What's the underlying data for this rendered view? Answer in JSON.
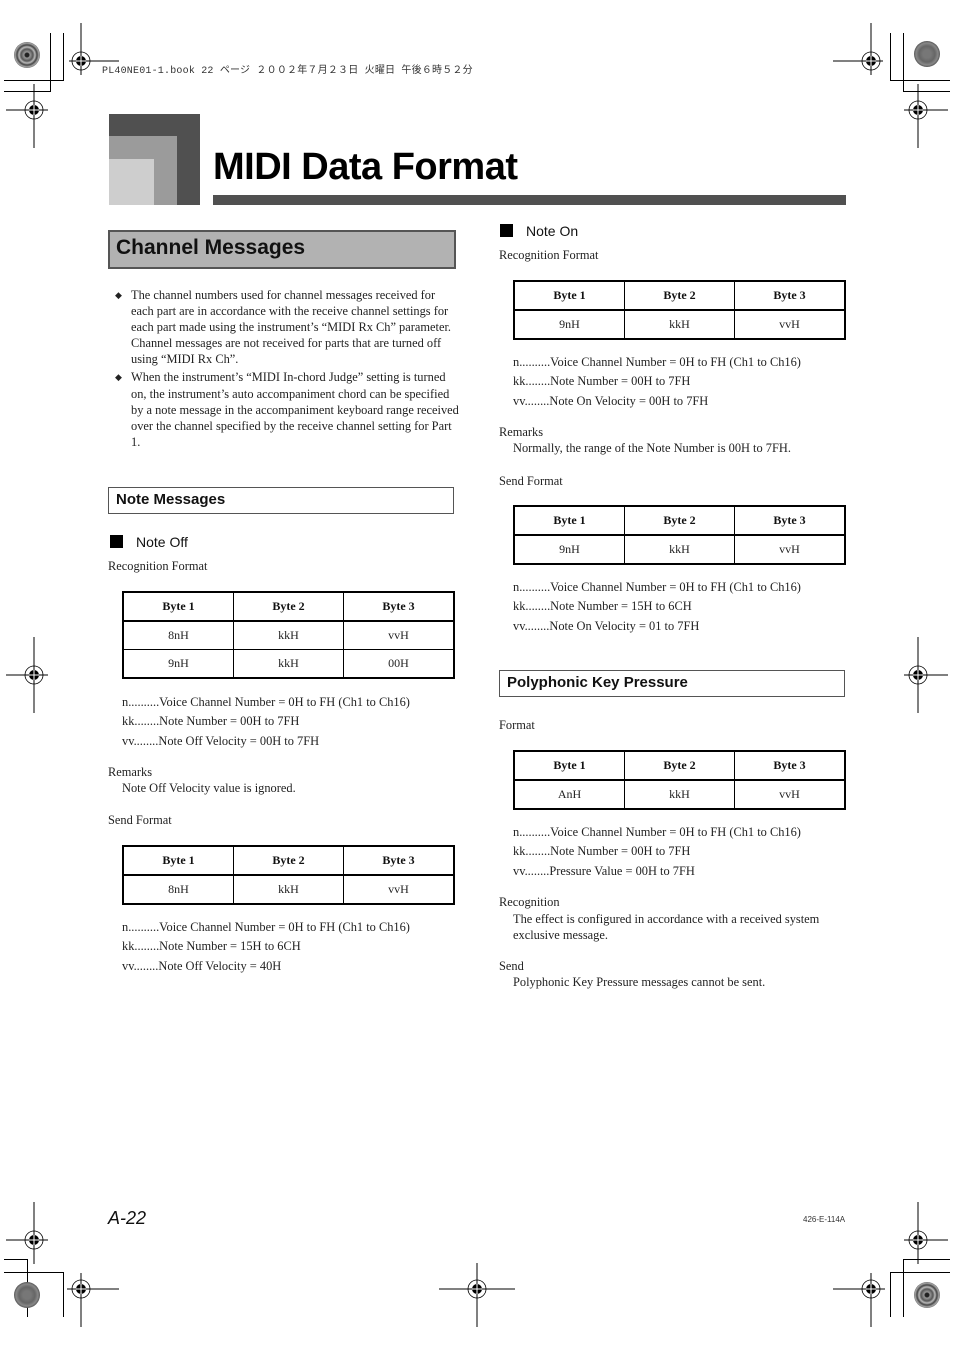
{
  "print_header": {
    "text": "PL40NE01-1.book  22 ページ  ２００２年７月２３日  火曜日  午後６時５２分"
  },
  "page_title": "MIDI Data Format",
  "section": {
    "title": "Channel Messages",
    "bullets": [
      "The channel numbers used for channel messages received for each part are in accordance with the receive channel settings for each part made using the instrument’s “MIDI Rx Ch” parameter. Channel messages are not received for parts that are turned off using “MIDI Rx Ch”.",
      "When the instrument’s “MIDI In-chord Judge” setting is turned on, the instrument’s auto accompaniment chord can be specified by a note message in the accompaniment keyboard range received over the channel specified by the receive channel setting for Part 1."
    ],
    "bullet_glyph": "◆"
  },
  "note_messages": {
    "title": "Note Messages",
    "note_off": {
      "title": "Note Off",
      "recognition_label": "Recognition Format",
      "recognition_table": {
        "headers": [
          "Byte 1",
          "Byte 2",
          "Byte 3"
        ],
        "rows": [
          [
            "8nH",
            "kkH",
            "vvH"
          ],
          [
            "9nH",
            "kkH",
            "00H"
          ]
        ]
      },
      "recognition_defs": [
        "n..........Voice Channel Number = 0H to FH (Ch1 to Ch16)",
        "kk........Note Number = 00H to 7FH",
        "vv........Note Off Velocity = 00H to 7FH"
      ],
      "remarks_label": "Remarks",
      "remarks_text": "Note Off Velocity value is ignored.",
      "send_label": "Send Format",
      "send_table": {
        "headers": [
          "Byte 1",
          "Byte 2",
          "Byte 3"
        ],
        "rows": [
          [
            "8nH",
            "kkH",
            "vvH"
          ]
        ]
      },
      "send_defs": [
        "n..........Voice Channel Number = 0H to FH (Ch1 to Ch16)",
        "kk........Note Number = 15H to 6CH",
        "vv........Note Off Velocity = 40H"
      ]
    },
    "note_on": {
      "title": "Note On",
      "recognition_label": "Recognition Format",
      "recognition_table": {
        "headers": [
          "Byte 1",
          "Byte 2",
          "Byte 3"
        ],
        "rows": [
          [
            "9nH",
            "kkH",
            "vvH"
          ]
        ]
      },
      "recognition_defs": [
        "n..........Voice Channel Number = 0H to FH (Ch1 to Ch16)",
        "kk........Note Number = 00H to 7FH",
        "vv........Note On Velocity = 00H to 7FH"
      ],
      "remarks_label": "Remarks",
      "remarks_text": "Normally, the range of the Note Number is 00H to 7FH.",
      "send_label": "Send Format",
      "send_table": {
        "headers": [
          "Byte 1",
          "Byte 2",
          "Byte 3"
        ],
        "rows": [
          [
            "9nH",
            "kkH",
            "vvH"
          ]
        ]
      },
      "send_defs": [
        "n..........Voice Channel Number = 0H to FH (Ch1 to Ch16)",
        "kk........Note Number = 15H to 6CH",
        "vv........Note On Velocity = 01 to 7FH"
      ]
    }
  },
  "poly_pressure": {
    "title": "Polyphonic Key Pressure",
    "format_label": "Format",
    "table": {
      "headers": [
        "Byte 1",
        "Byte 2",
        "Byte 3"
      ],
      "rows": [
        [
          "AnH",
          "kkH",
          "vvH"
        ]
      ]
    },
    "defs": [
      "n..........Voice Channel Number = 0H to FH (Ch1 to Ch16)",
      "kk........Note Number = 00H to 7FH",
      "vv........Pressure Value = 00H to 7FH"
    ],
    "recognition_label": "Recognition",
    "recognition_text": "The effect is configured in accordance with a received system exclusive message.",
    "send_label": "Send",
    "send_text": "Polyphonic Key Pressure messages cannot be sent."
  },
  "footer": {
    "page_number": "A-22",
    "doc_code": "426-E-114A"
  }
}
